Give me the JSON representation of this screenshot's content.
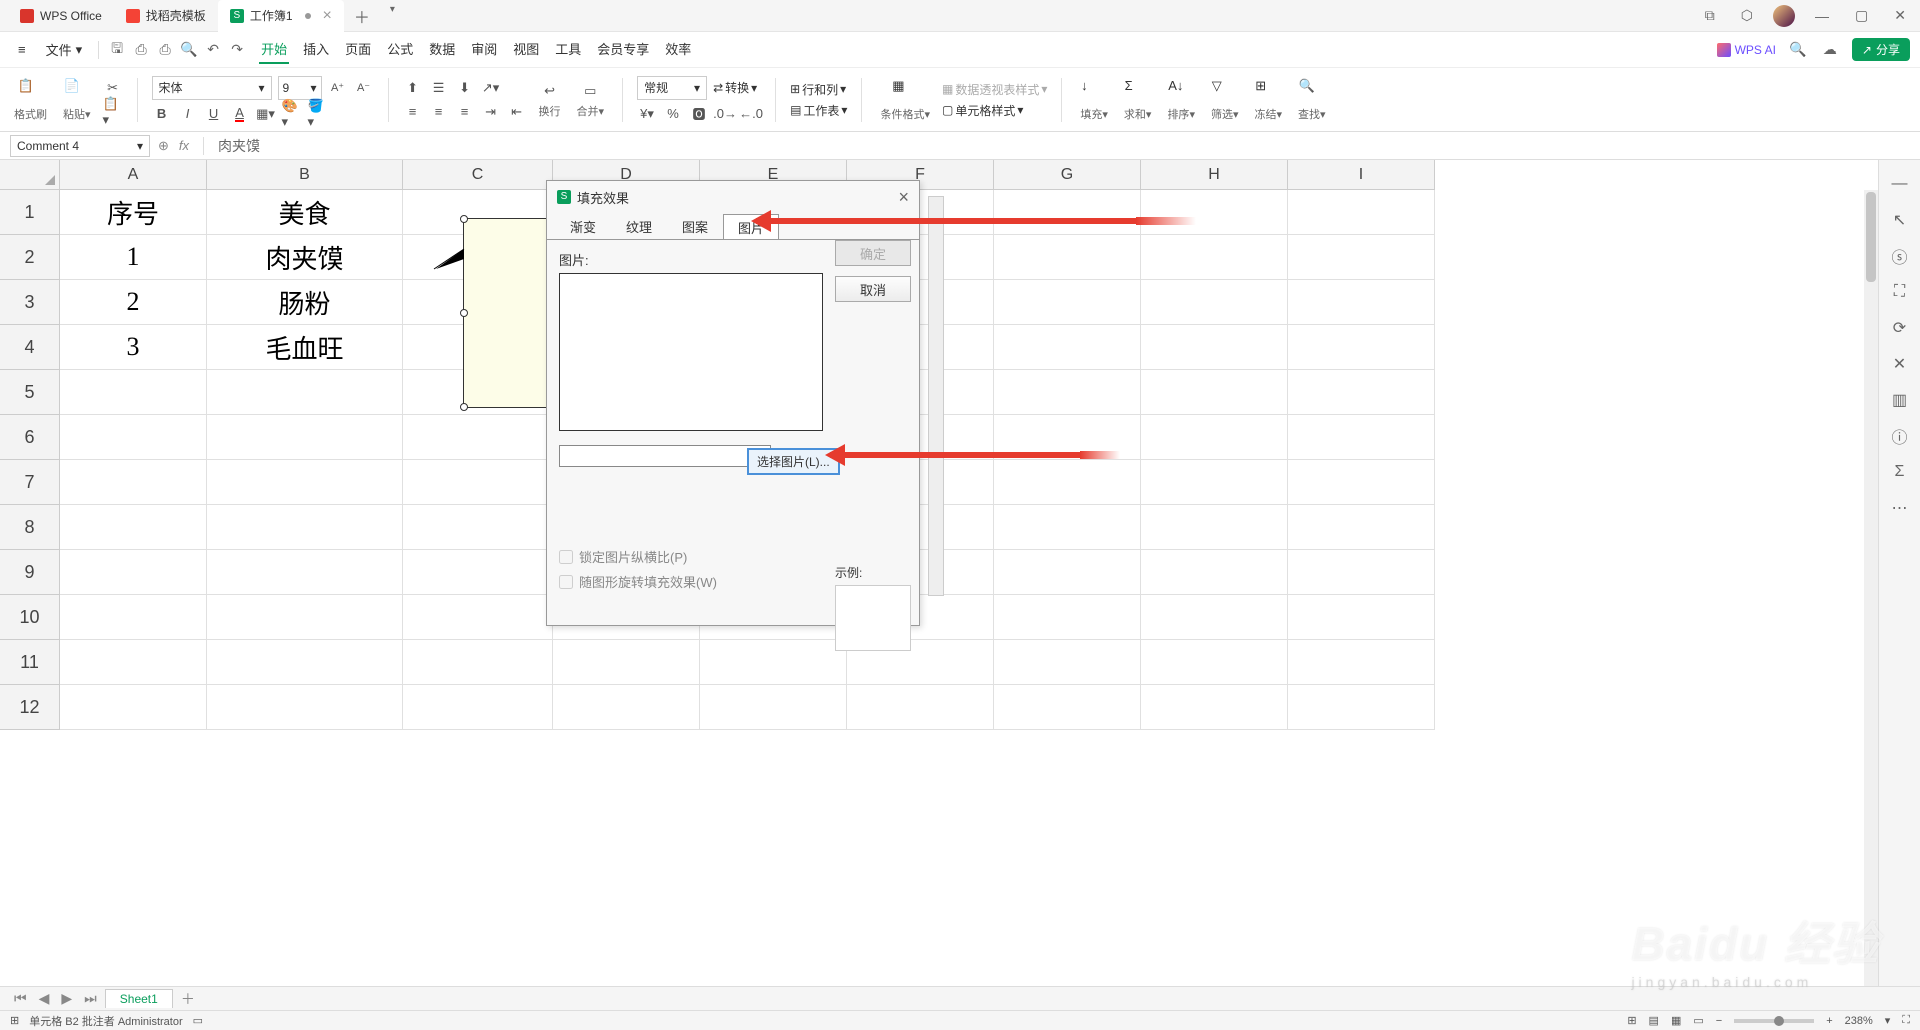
{
  "titlebar": {
    "tabs": [
      {
        "label": "WPS Office",
        "icon": "wps"
      },
      {
        "label": "找稻壳模板",
        "icon": "docer"
      },
      {
        "label": "工作簿1",
        "icon": "sheet",
        "dirty": true
      }
    ]
  },
  "menu": {
    "file": "文件",
    "items": [
      "开始",
      "插入",
      "页面",
      "公式",
      "数据",
      "审阅",
      "视图",
      "工具",
      "会员专享",
      "效率"
    ],
    "active": "开始",
    "wps_ai": "WPS AI",
    "share": "分享"
  },
  "toolbar": {
    "format_painter": "格式刷",
    "paste": "粘贴",
    "font_name": "宋体",
    "font_size": "9",
    "number_format": "常规",
    "convert": "转换",
    "rowcol": "行和列",
    "worksheet": "工作表",
    "cond_format": "条件格式",
    "pivot_style": "数据透视表样式",
    "cell_style": "单元格样式",
    "fill": "填充",
    "sum": "求和",
    "sort": "排序",
    "filter": "筛选",
    "freeze": "冻结",
    "find": "查找",
    "wrap": "换行",
    "merge": "合并"
  },
  "namebox": "Comment 4",
  "formula": "肉夹馍",
  "grid": {
    "cols": [
      "A",
      "B",
      "C",
      "D",
      "E",
      "F",
      "G",
      "H",
      "I"
    ],
    "rows": [
      "1",
      "2",
      "3",
      "4",
      "5",
      "6",
      "7",
      "8",
      "9",
      "10",
      "11",
      "12"
    ],
    "data": [
      [
        "序号",
        "美食"
      ],
      [
        "1",
        "肉夹馍"
      ],
      [
        "2",
        "肠粉"
      ],
      [
        "3",
        "毛血旺"
      ]
    ]
  },
  "dialog": {
    "title": "填充效果",
    "tabs": [
      "渐变",
      "纹理",
      "图案",
      "图片"
    ],
    "active_tab": "图片",
    "picture_label": "图片:",
    "select_picture": "选择图片(L)...",
    "ok": "确定",
    "cancel": "取消",
    "sample": "示例:",
    "lock_ratio": "锁定图片纵横比(P)",
    "rotate_fill": "随图形旋转填充效果(W)"
  },
  "sheetbar": {
    "sheet": "Sheet1"
  },
  "status": {
    "cell_info": "单元格 B2 批注者 Administrator",
    "zoom": "238%"
  },
  "watermark": {
    "main": "Baidu 经验",
    "sub": "jingyan.baidu.com"
  }
}
